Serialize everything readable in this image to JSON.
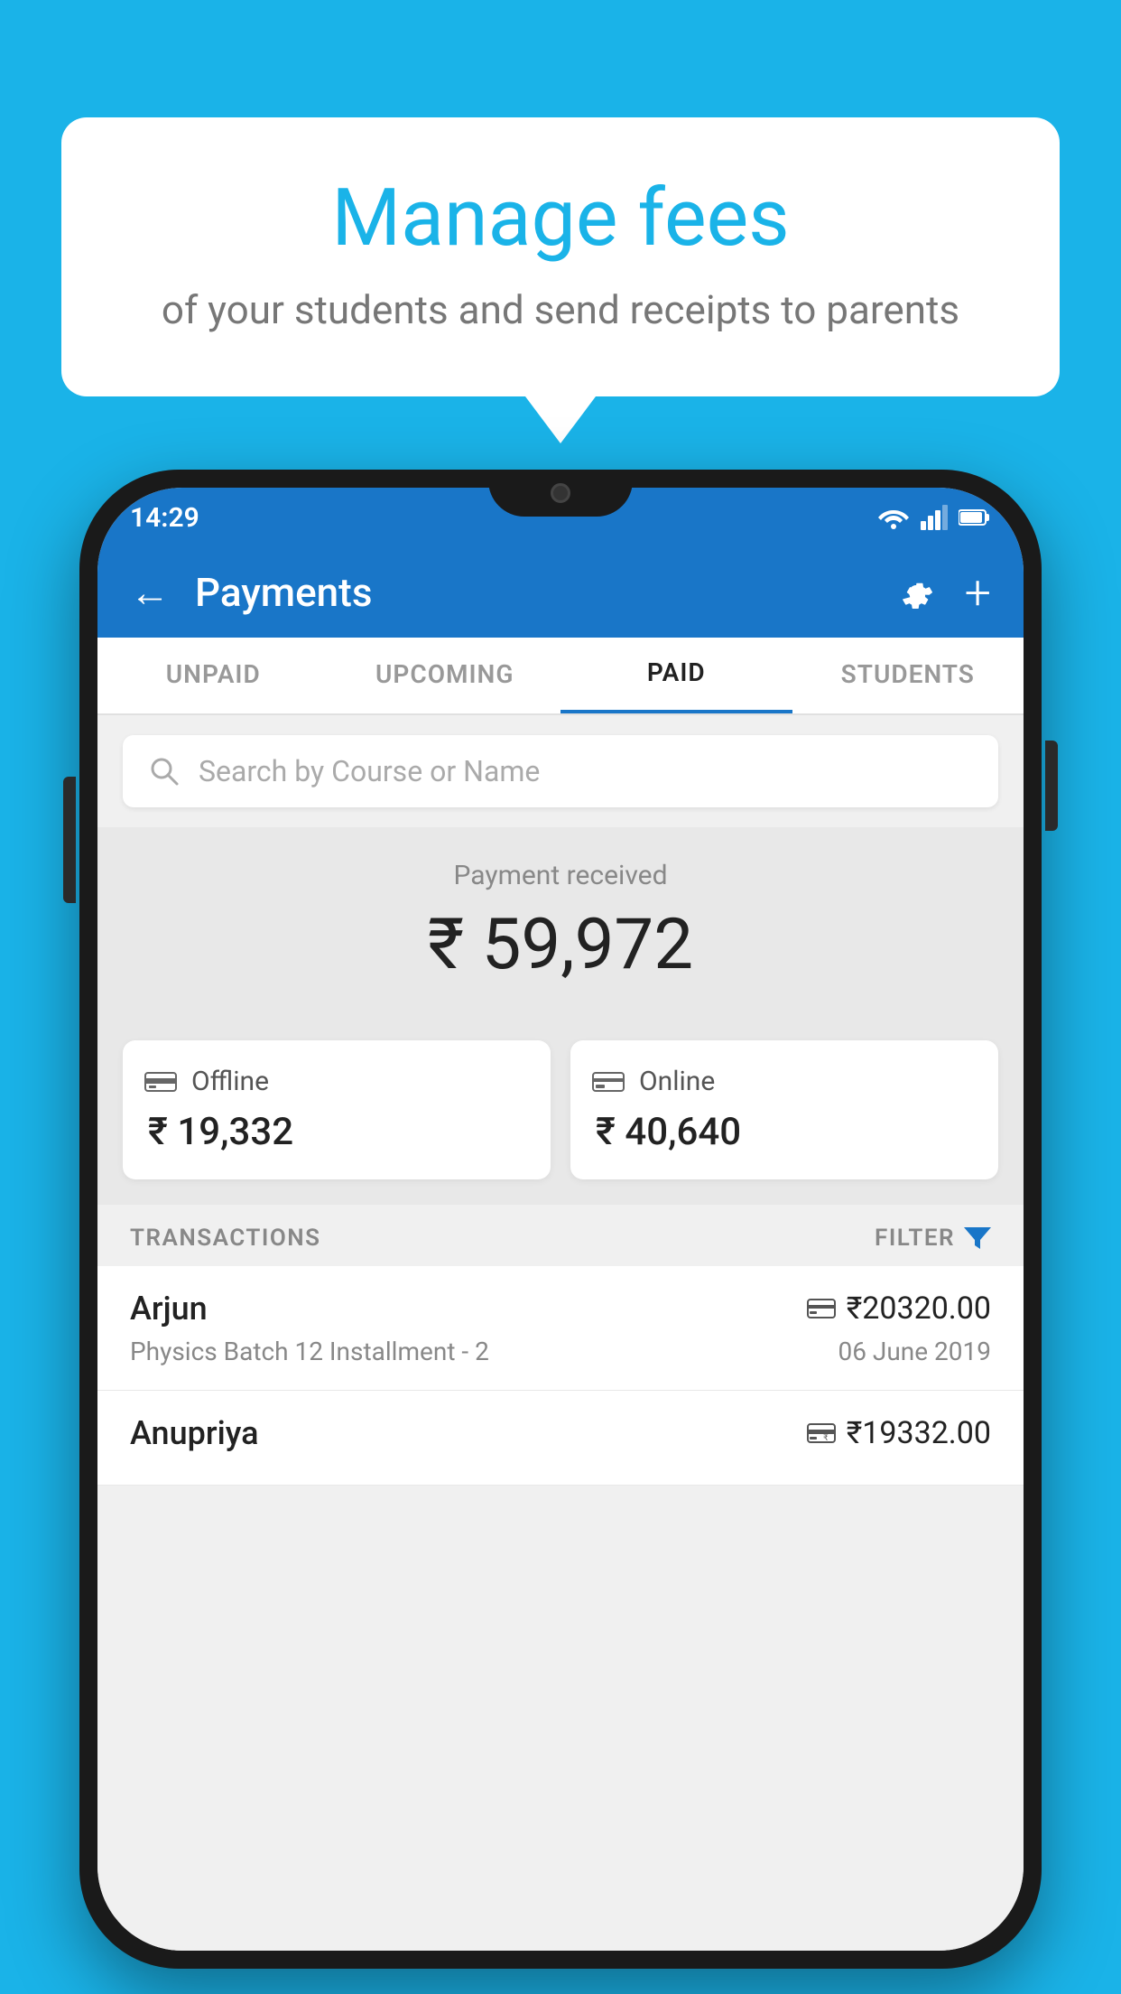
{
  "background_color": "#1ab3e8",
  "speech_bubble": {
    "title": "Manage fees",
    "subtitle": "of your students and send receipts to parents"
  },
  "status_bar": {
    "time": "14:29",
    "wifi": "▼",
    "signal": "▲",
    "battery": "▮"
  },
  "header": {
    "title": "Payments",
    "back_label": "←",
    "gear_label": "⚙",
    "plus_label": "+"
  },
  "tabs": [
    {
      "label": "UNPAID",
      "active": false
    },
    {
      "label": "UPCOMING",
      "active": false
    },
    {
      "label": "PAID",
      "active": true
    },
    {
      "label": "STUDENTS",
      "active": false
    }
  ],
  "search": {
    "placeholder": "Search by Course or Name"
  },
  "payment": {
    "received_label": "Payment received",
    "total_amount": "₹ 59,972",
    "offline": {
      "label": "Offline",
      "amount": "₹ 19,332"
    },
    "online": {
      "label": "Online",
      "amount": "₹ 40,640"
    }
  },
  "transactions": {
    "header_label": "TRANSACTIONS",
    "filter_label": "FILTER",
    "rows": [
      {
        "name": "Arjun",
        "detail": "Physics Batch 12 Installment - 2",
        "amount": "₹20320.00",
        "date": "06 June 2019",
        "payment_type": "online"
      },
      {
        "name": "Anupriya",
        "detail": "",
        "amount": "₹19332.00",
        "date": "",
        "payment_type": "offline"
      }
    ]
  }
}
